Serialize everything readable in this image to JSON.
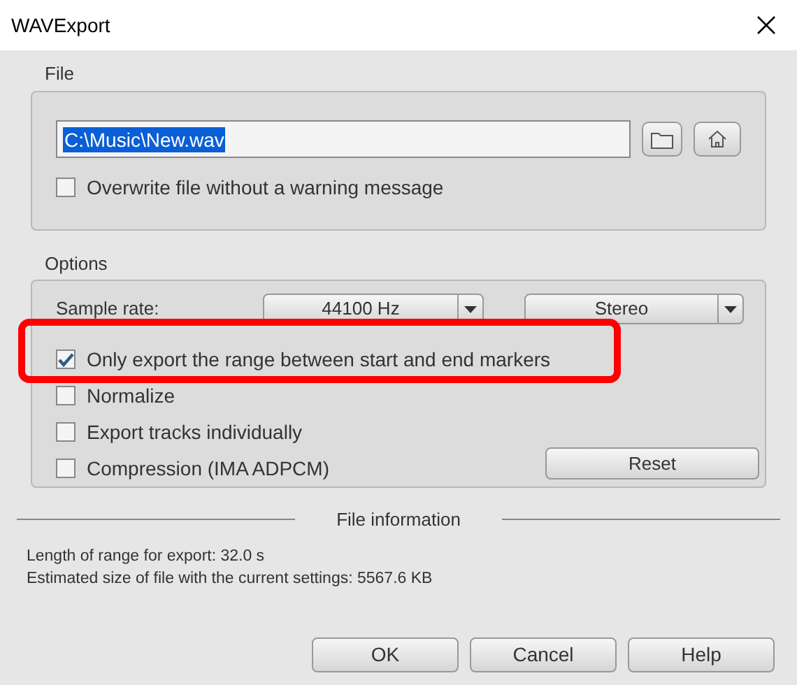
{
  "window": {
    "title": "WAVExport"
  },
  "file": {
    "label": "File",
    "path": "C:\\Music\\New.wav",
    "path_selected": true,
    "overwrite": {
      "label": "Overwrite file without a warning message",
      "checked": false
    }
  },
  "options": {
    "label": "Options",
    "sample_rate_label": "Sample rate:",
    "sample_rate": "44100 Hz",
    "channels": "Stereo",
    "checkboxes": [
      {
        "label": "Only export the range between start and end markers",
        "checked": true,
        "highlighted": true
      },
      {
        "label": "Normalize",
        "checked": false,
        "highlighted": false
      },
      {
        "label": "Export tracks individually",
        "checked": false,
        "highlighted": false
      },
      {
        "label": "Compression (IMA ADPCM)",
        "checked": false,
        "highlighted": false
      }
    ],
    "reset": "Reset"
  },
  "file_information": {
    "title": "File information",
    "lines": [
      "Length of range for export: 32.0 s",
      "Estimated size of file with the current settings: 5567.6 KB"
    ]
  },
  "buttons": [
    "OK",
    "Cancel",
    "Help"
  ]
}
